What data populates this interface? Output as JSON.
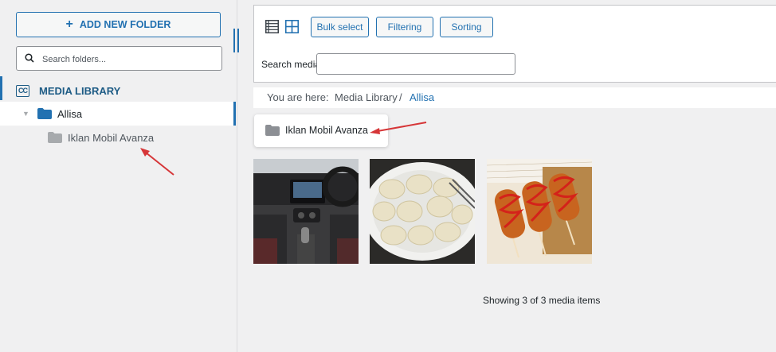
{
  "sidebar": {
    "add_folder_label": "ADD NEW FOLDER",
    "search_placeholder": "Search folders...",
    "library_title": "MEDIA LIBRARY",
    "folders": [
      {
        "label": "Allisa",
        "color": "#2271b1"
      },
      {
        "label": "Iklan Mobil Avanza",
        "color": "#a7aaad"
      }
    ]
  },
  "toolbar": {
    "view_modes": [
      "list-view-icon",
      "grid-view-icon"
    ],
    "bulk_select_label": "Bulk select",
    "filtering_label": "Filtering",
    "sorting_label": "Sorting",
    "search_label": "Search media",
    "search_value": ""
  },
  "breadcrumb": {
    "prefix": "You are here",
    "separator1": ":",
    "root": "Media Library",
    "separator2": "/",
    "current": "Allisa"
  },
  "content": {
    "subfolders": [
      {
        "label": "Iklan Mobil Avanza"
      }
    ],
    "media_items": [
      {
        "subject": "car interior dashboard"
      },
      {
        "subject": "plate of dumplings"
      },
      {
        "subject": "corn dogs with ketchup"
      }
    ],
    "count_text": "Showing 3 of 3 media items"
  },
  "colors": {
    "accent": "#2271b1",
    "library_title": "#1d5b85",
    "annotation_arrow": "#d63638"
  }
}
